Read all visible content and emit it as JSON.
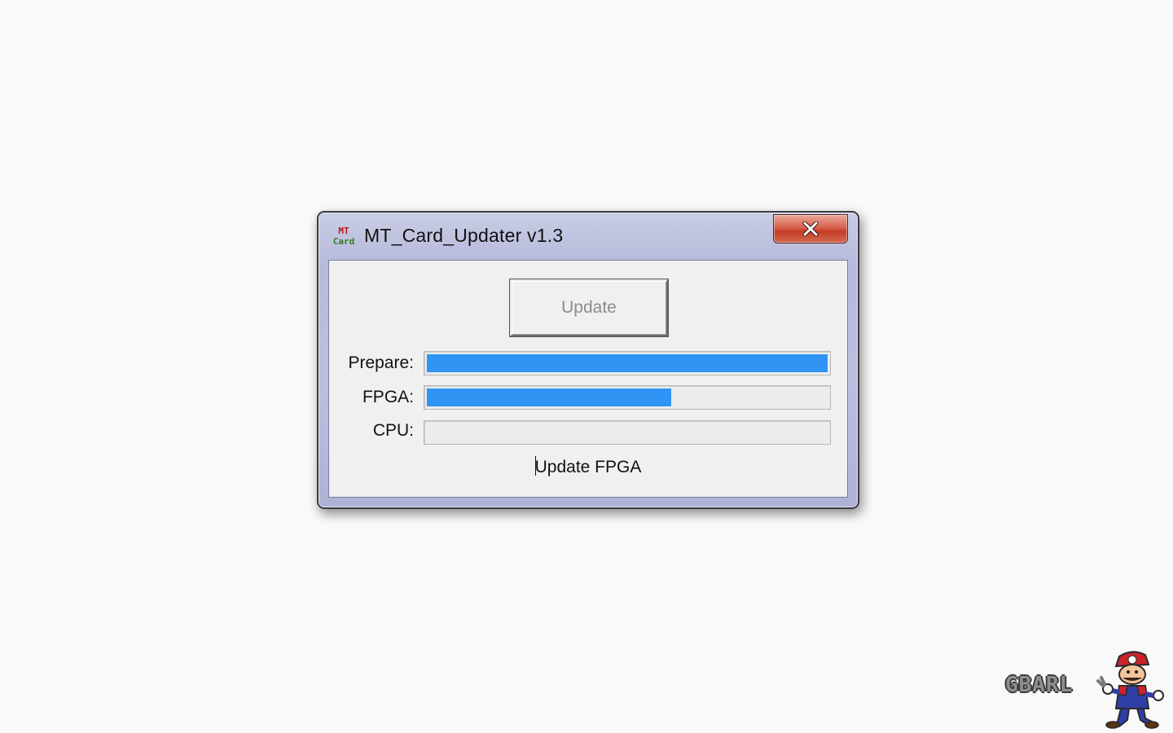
{
  "window": {
    "title": "MT_Card_Updater v1.3",
    "icon": {
      "line1": "MT",
      "line2": "Card",
      "name": "mt-card-app-icon"
    },
    "close_icon": "close-icon"
  },
  "main": {
    "update_button_label": "Update",
    "rows": [
      {
        "label": "Prepare:",
        "progress": 1.0
      },
      {
        "label": "FPGA:",
        "progress": 0.61
      },
      {
        "label": "CPU:",
        "progress": 0.0
      }
    ],
    "status": "Update FPGA"
  },
  "watermark": {
    "text": "GBARL"
  },
  "colors": {
    "progress_fill": "#3094f5",
    "close_button": "#c53b26",
    "icon_mt": "#c0161d",
    "icon_card": "#2f7c1f"
  }
}
